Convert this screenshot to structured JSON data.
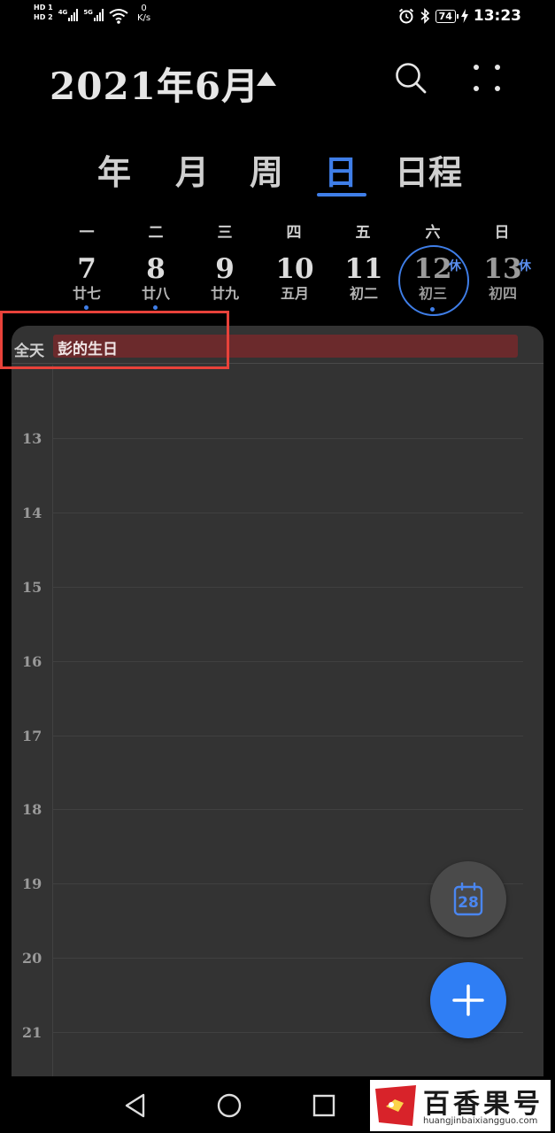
{
  "status_bar": {
    "sim1": "HD 1",
    "sim2": "HD 2",
    "net1": "4G",
    "net2": "5G",
    "speed_value": "0",
    "speed_unit": "K/s",
    "battery": "74",
    "time": "13:23"
  },
  "header": {
    "month_title": "2021年6月"
  },
  "view_tabs": [
    "年",
    "月",
    "周",
    "日",
    "日程"
  ],
  "active_tab": "日",
  "week": {
    "weekdays": [
      "一",
      "二",
      "三",
      "四",
      "五",
      "六",
      "日"
    ],
    "days": [
      {
        "num": "7",
        "lunar": "廿七"
      },
      {
        "num": "8",
        "lunar": "廿八"
      },
      {
        "num": "9",
        "lunar": "廿九"
      },
      {
        "num": "10",
        "lunar": "五月"
      },
      {
        "num": "11",
        "lunar": "初二"
      },
      {
        "num": "12",
        "lunar": "初三",
        "badge": "休"
      },
      {
        "num": "13",
        "lunar": "初四",
        "badge": "休"
      }
    ]
  },
  "timeline": {
    "allday_label": "全天",
    "allday_event": "彭的生日",
    "hours": [
      "13",
      "14",
      "15",
      "16",
      "17",
      "18",
      "19",
      "20",
      "21"
    ]
  },
  "fab": {
    "today_number": "28"
  },
  "watermark": {
    "title": "百香果号",
    "url": "huangjinbaixiangguo.com"
  },
  "colors": {
    "accent": "#3f7ee8",
    "fab_add": "#2f7ef4",
    "allday_event": "#6b2a2c",
    "highlight": "#e8423a",
    "panel": "#333333"
  }
}
